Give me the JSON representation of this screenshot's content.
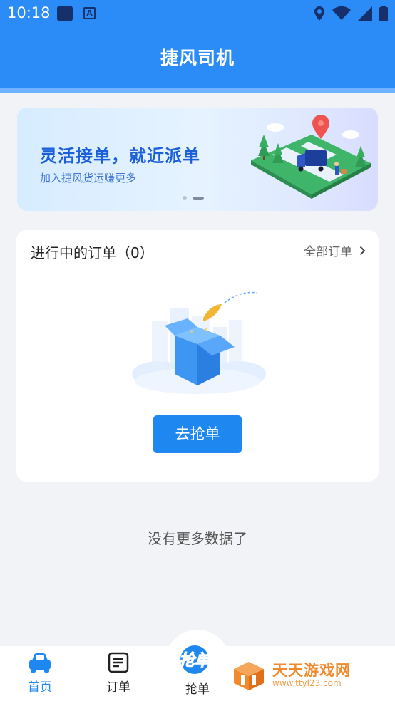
{
  "status_bar": {
    "time": "10:18",
    "icons": [
      "app-square-icon",
      "a-badge-icon",
      "location-icon",
      "wifi-icon",
      "signal-icon",
      "battery-icon"
    ],
    "a_badge": "A"
  },
  "header": {
    "title": "捷风司机",
    "background": "#2b8cf7"
  },
  "banner": {
    "headline": "灵活接单，就近派单",
    "subtitle": "加入捷风货运赚更多",
    "pages": 2,
    "active_page": 2
  },
  "orders_card": {
    "title": "进行中的订单（0）",
    "all_orders_link": "全部订单",
    "empty_button": "去抢单"
  },
  "list_footer": "没有更多数据了",
  "bottom_nav": {
    "items": [
      {
        "label": "首页",
        "icon": "car-icon",
        "active": true
      },
      {
        "label": "订单",
        "icon": "document-icon",
        "active": false
      },
      {
        "label": "抢单",
        "icon": "grab-order-logo",
        "active": false
      }
    ],
    "grab_logo_text": "抢单"
  },
  "watermark": {
    "name": "天天游戏网",
    "url": "www.ttyl23.com"
  },
  "colors": {
    "primary": "#1f88f0",
    "accent_orange": "#f08a2c"
  }
}
